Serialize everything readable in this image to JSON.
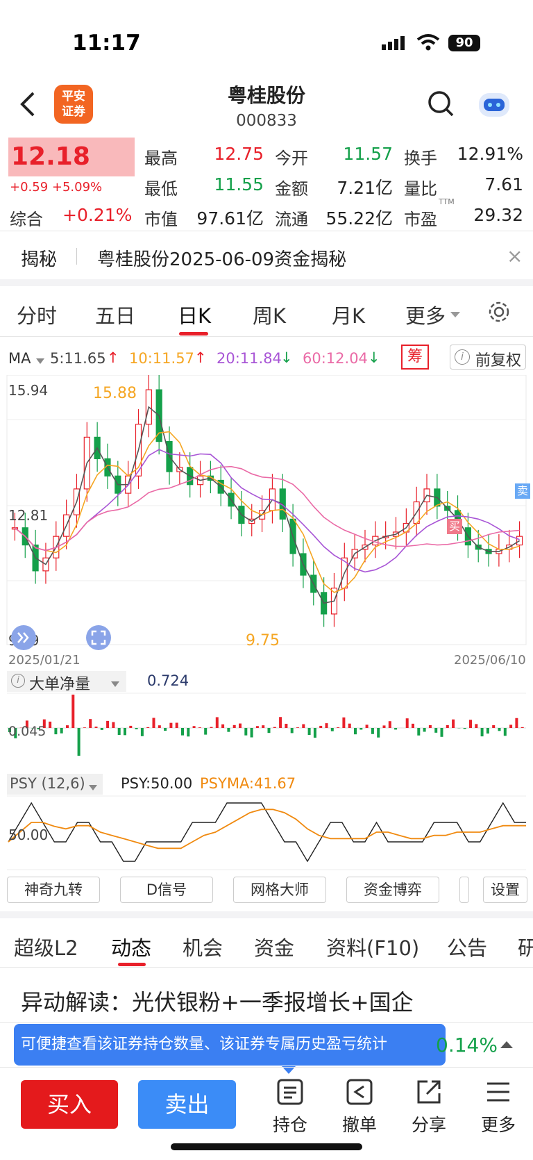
{
  "status_bar": {
    "time": "11:17",
    "battery": "90"
  },
  "header": {
    "logo_text_1": "平安",
    "logo_text_2": "证券",
    "title": "粤桂股份",
    "code": "000833"
  },
  "quote": {
    "price": "12.18",
    "change": "+0.59 +5.09%",
    "composite_label": "综合",
    "composite_value": "+0.21%",
    "fields": [
      {
        "label": "最高",
        "value": "12.75",
        "color": "red"
      },
      {
        "label": "今开",
        "value": "11.57",
        "color": "green"
      },
      {
        "label": "换手",
        "value": "12.91%",
        "color": "black"
      },
      {
        "label": "最低",
        "value": "11.55",
        "color": "green"
      },
      {
        "label": "金额",
        "value": "7.21亿",
        "color": "black"
      },
      {
        "label": "量比",
        "value": "7.61",
        "color": "black"
      },
      {
        "label": "市值",
        "value": "97.61亿",
        "color": "black"
      },
      {
        "label": "流通",
        "value": "55.22亿",
        "color": "black"
      },
      {
        "label": "市盈",
        "value": "29.32",
        "color": "black",
        "sup": "TTM"
      }
    ]
  },
  "notice": {
    "label": "揭秘",
    "text": "粤桂股份2025-06-09资金揭秘",
    "close": "×"
  },
  "chart_tabs": [
    "分时",
    "五日",
    "日K",
    "周K",
    "月K",
    "更多"
  ],
  "ma": {
    "label": "MA",
    "ma5": "5:11.65",
    "ma10": "10:11.57",
    "ma20": "20:11.84",
    "ma60": "60:12.04",
    "chip_button": "筹",
    "adjust_button": "前复权"
  },
  "kline": {
    "y_top": "15.94",
    "y_mid": "12.81",
    "y_low": "9.69",
    "high_mark": "15.88",
    "low_mark": "9.75",
    "date_start": "2025/01/21",
    "date_end": "2025/06/10",
    "buy_tag": "买",
    "sell_tag": "卖"
  },
  "big_order": {
    "label": "大单净量",
    "value": "0.724",
    "axis": "0.045"
  },
  "psy": {
    "label": "PSY (12,6)",
    "psy": "PSY:50.00",
    "psyma": "PSYMA:41.67",
    "axis": "50.00"
  },
  "tools": [
    "神奇九转",
    "D信号",
    "网格大师",
    "资金博弈",
    "设置"
  ],
  "section_tabs": [
    "超级L2",
    "动态",
    "机会",
    "资金",
    "资料(F10)",
    "公告",
    "研"
  ],
  "news": {
    "headline": "异动解读：光伏银粉+一季报增长+国企"
  },
  "tooltip": {
    "text": "可便捷查看该证券持仓数量、该证券专属历史盈亏统计",
    "right_value": "0.14%"
  },
  "bottom_bar": {
    "buy": "买入",
    "sell": "卖出",
    "items": [
      "持仓",
      "撤单",
      "分享",
      "更多"
    ]
  },
  "colors": {
    "up": "#e8202a",
    "down": "#14a04a",
    "ma5": "#555555",
    "ma10": "#f5a623",
    "ma20": "#a855d6",
    "ma60": "#ea6aa6"
  }
}
